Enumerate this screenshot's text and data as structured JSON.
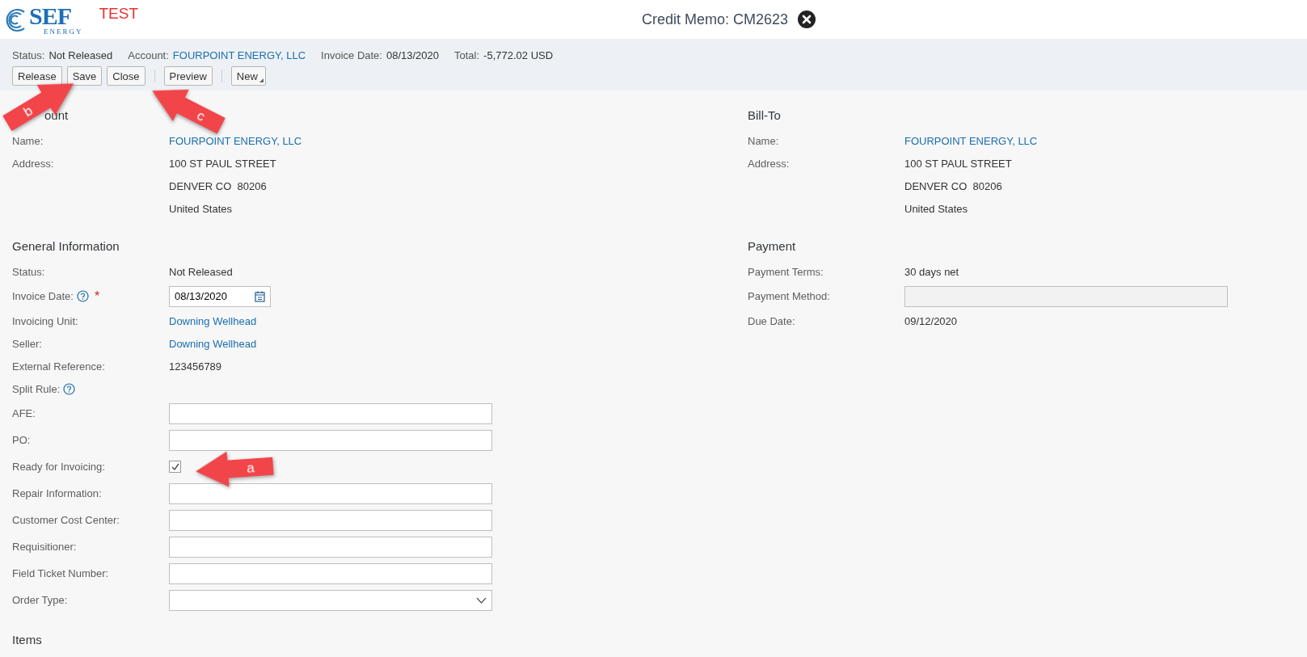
{
  "header": {
    "logo_text": "SEF",
    "logo_subtext": "ENERGY",
    "environment": "TEST",
    "title": "Credit Memo: CM2623"
  },
  "summary": [
    {
      "label": "Status:",
      "value": "Not Released",
      "kind": "text"
    },
    {
      "label": "Account:",
      "value": "FOURPOINT ENERGY, LLC",
      "kind": "link"
    },
    {
      "label": "Invoice Date:",
      "value": "08/13/2020",
      "kind": "text"
    },
    {
      "label": "Total:",
      "value": "-5,772.02 USD",
      "kind": "text"
    }
  ],
  "toolbar": [
    {
      "kind": "button",
      "label": "Release"
    },
    {
      "kind": "button",
      "label": "Save"
    },
    {
      "kind": "button",
      "label": "Close"
    },
    {
      "kind": "separator"
    },
    {
      "kind": "button",
      "label": "Preview"
    },
    {
      "kind": "separator"
    },
    {
      "kind": "menu_button",
      "label": "New"
    }
  ],
  "left_column": [
    {
      "title": "ount",
      "rows": [
        {
          "kind": "link",
          "label": "Name:",
          "value": "FOURPOINT ENERGY, LLC"
        },
        {
          "kind": "text",
          "label": "Address:",
          "value": "100 ST PAUL STREET"
        },
        {
          "kind": "text",
          "value": "DENVER CO  80206"
        },
        {
          "kind": "text",
          "value": "United States"
        }
      ]
    },
    {
      "title": "General Information",
      "rows": [
        {
          "kind": "text",
          "label": "Status:",
          "value": "Not Released"
        },
        {
          "kind": "date",
          "label": "Invoice Date:",
          "help": true,
          "required_mark": "*",
          "value": "08/13/2020"
        },
        {
          "kind": "link",
          "label": "Invoicing Unit:",
          "value": "Downing Wellhead"
        },
        {
          "kind": "link",
          "label": "Seller:",
          "value": "Downing Wellhead"
        },
        {
          "kind": "text",
          "label": "External Reference:",
          "value": "123456789"
        },
        {
          "kind": "text",
          "label": "Split Rule:",
          "help": true
        },
        {
          "kind": "input",
          "label": "AFE:"
        },
        {
          "kind": "input",
          "label": "PO:"
        },
        {
          "kind": "checkbox",
          "label": "Ready for Invoicing:",
          "checked": true
        },
        {
          "kind": "input",
          "label": "Repair Information:"
        },
        {
          "kind": "input",
          "label": "Customer Cost Center:"
        },
        {
          "kind": "input",
          "label": "Requisitioner:"
        },
        {
          "kind": "input",
          "label": "Field Ticket Number:"
        },
        {
          "kind": "select",
          "label": "Order Type:"
        }
      ]
    },
    {
      "title": "Items"
    }
  ],
  "right_column": [
    {
      "title": "Bill-To",
      "rows": [
        {
          "kind": "link",
          "label": "Name:",
          "value": "FOURPOINT ENERGY, LLC"
        },
        {
          "kind": "text",
          "label": "Address:",
          "value": "100 ST PAUL STREET"
        },
        {
          "kind": "text",
          "value": "DENVER CO  80206"
        },
        {
          "kind": "text",
          "value": "United States"
        }
      ]
    },
    {
      "title": "Payment",
      "rows": [
        {
          "kind": "text",
          "label": "Payment Terms:",
          "value": "30 days net"
        },
        {
          "kind": "disabled_input",
          "label": "Payment Method:"
        },
        {
          "kind": "text",
          "label": "Due Date:",
          "value": "09/12/2020"
        }
      ]
    }
  ],
  "annotations": [
    {
      "label": "a"
    },
    {
      "label": "b"
    },
    {
      "label": "c"
    }
  ]
}
